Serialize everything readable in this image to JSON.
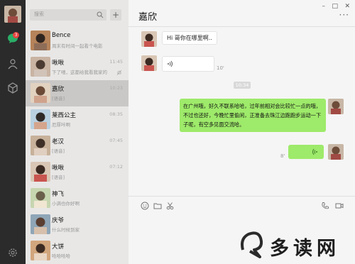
{
  "search": {
    "placeholder": "搜索"
  },
  "chat_list": [
    {
      "name": "Bence",
      "preview": "周末有时间一起看个电影",
      "time": "",
      "active": false,
      "muted": false
    },
    {
      "name": "啾啾",
      "preview": "下了嘻，这都给我看我家的",
      "time": "11:45",
      "active": false,
      "muted": true
    },
    {
      "name": "嘉欣",
      "preview": "[语音]",
      "time": "10:23",
      "active": true,
      "muted": false
    },
    {
      "name": "莱西公主",
      "preview": "厄厚咔啊",
      "time": "08:35",
      "active": false,
      "muted": false
    },
    {
      "name": "老汉",
      "preview": "[语音]",
      "time": "07:45",
      "active": false,
      "muted": false
    },
    {
      "name": "啾啾",
      "preview": "[语音]",
      "time": "07:12",
      "active": false,
      "muted": false
    },
    {
      "name": "神飞",
      "preview": "小满也你好啊",
      "time": "",
      "active": false,
      "muted": false
    },
    {
      "name": "庆爷",
      "preview": "什么时候到家",
      "time": "",
      "active": false,
      "muted": false
    },
    {
      "name": "大饼",
      "preview": "哈哈哈哈",
      "time": "",
      "active": false,
      "muted": false
    }
  ],
  "badge_count": "3",
  "chat": {
    "title": "嘉欣",
    "more": "···",
    "win_min": "–",
    "win_max": "□",
    "win_close": "✕",
    "msg1": "Hi 哥你在哪里啊..",
    "voice_in_duration": "10'",
    "timestamp": "10:34",
    "out_text": "在广州哦，好久不联系哈哈，过年前相对会比较忙一点的哦，不过也还好，今晚忙里偷闲，正准备去珠江边跑跑步运动一下子呢，有空多见面交流哈。",
    "voice_out_duration": "8'"
  },
  "watermark": {
    "text": "多读网"
  },
  "colors": {
    "rail": "#2b2b2b",
    "list": "#e8e7e6",
    "active": "#cac8c6",
    "out_bubble": "#9eea6a",
    "badge": "#e64340"
  }
}
